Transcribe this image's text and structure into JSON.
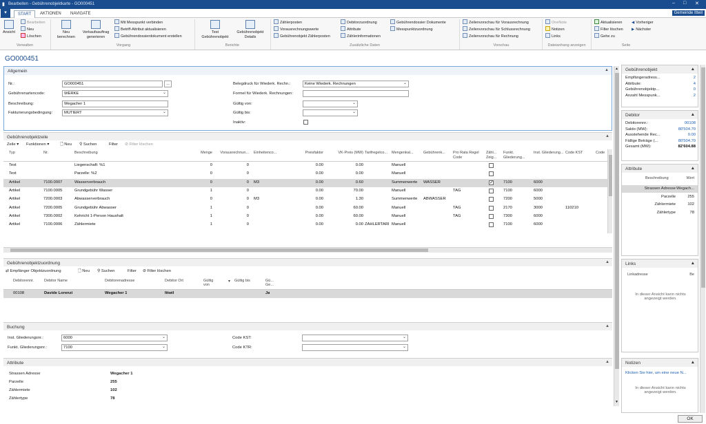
{
  "window": {
    "title": "Bearbeiten - Gebührenobjektkarte - GO000451",
    "company": "Gemeinde Ittwil"
  },
  "tabs": [
    "START",
    "AKTIONEN",
    "NAVIGATE"
  ],
  "ribbon": {
    "verwalten": {
      "label": "Verwalten",
      "ansicht": "Ansicht",
      "bearbeiten": "Bearbeiten",
      "neu": "Neu",
      "loeschen": "Löschen"
    },
    "vorgang": {
      "label": "Vorgang",
      "neu_berechnen": "Neu berechnen",
      "verkaufsauftrag": "Verkaufsauftrag generieren",
      "messpunkt": "Mit Messpunkt verbinden",
      "betriff": "Betriff-Attribut aktualisieren",
      "dokument": "Gebührendossierdokument erstellen"
    },
    "berichte": {
      "label": "Berichte",
      "test": "Test Gebührenobjekt",
      "details": "Gebührenobjekt Details"
    },
    "zusatz": {
      "label": "Zusätzliche Daten",
      "zaehlerposten": "Zählerposten",
      "vorausrechnungswerte": "Vorausrechnungswerte",
      "gebuehrenobjekt_zaehlerposten": "Gebührenobjekt Zählerposten",
      "debitorzuordnung": "Debitorzuordnung",
      "attribute": "Attribute",
      "zaehlerinformationen": "Zählerinformationen",
      "dossier": "Gebührendossier Dokumente",
      "messpunktzuordnung": "Messpunktzuordnung"
    },
    "vorschau": {
      "label": "Vorschau",
      "v1": "Zeilenvorschau für Vorausrechnung",
      "v2": "Zeilenvorschau für Schlussrechnung",
      "v3": "Zeilenvorschau für Rechnung"
    },
    "datei": {
      "label": "Dateianhang anzeigen",
      "onenote": "OneNote",
      "notizen": "Notizen",
      "links": "Links"
    },
    "seite": {
      "label": "Seite",
      "aktualisieren": "Aktualisieren",
      "filter": "Filter löschen",
      "gehe": "Gehe zu",
      "vorheriger": "Vorheriger",
      "naechster": "Nächster"
    }
  },
  "page_title": "GO000451",
  "allgemein": {
    "title": "Allgemein",
    "nr_label": "Nr.:",
    "nr": "GO000451",
    "art_label": "Gebührenartencode:",
    "art": "WERKE",
    "beschr_label": "Beschreibung:",
    "beschr": "Wegacher 1",
    "fakt_label": "Fakturierungsbedingung:",
    "fakt": "MUTIERT",
    "beleg_label": "Belegdruck für Wiederk. Rechn.:",
    "beleg": "Keine Wiederk. Rechnungen",
    "formel_label": "Formel für Wiederk. Rechnungen:",
    "formel": "",
    "von_label": "Gültig von:",
    "bis_label": "Gültig bis:",
    "inaktiv_label": "Inaktiv:"
  },
  "zeile": {
    "title": "Gebührenobjektzeile",
    "toolbar": [
      "Zeile",
      "Funktionen",
      "Neu",
      "Suchen",
      "Filter",
      "Filter löschen"
    ],
    "headers": [
      "Typ",
      "Nr.",
      "Beschreibung",
      "Menge",
      "Vorausrechnun...",
      "Einheitenco...",
      "Preisfaktor",
      "VK-Preis (MW)",
      "Tarifregelco...",
      "Mengenkal...",
      "Gebührenk...",
      "Pro Rata Regel Code",
      "Zähl... Zeig...",
      "Funkt. Gliederung...",
      "Inst. Gliederung...",
      "Code KST",
      "Code"
    ],
    "rows": [
      {
        "typ": "Text",
        "nr": "",
        "beschr": "Liegenschaft: %1",
        "menge": "0",
        "vor": "0",
        "einh": "",
        "preis": "0.00",
        "vk": "0.00",
        "tarif": "",
        "mengen": "Manuell",
        "gebk": "",
        "prorata": "",
        "chk": false,
        "funkt": "",
        "inst": "",
        "kst": ""
      },
      {
        "typ": "Text",
        "nr": "",
        "beschr": "Parzelle: %2",
        "menge": "0",
        "vor": "0",
        "einh": "",
        "preis": "0.00",
        "vk": "0.00",
        "tarif": "",
        "mengen": "Manuell",
        "gebk": "",
        "prorata": "",
        "chk": false,
        "funkt": "",
        "inst": "",
        "kst": ""
      },
      {
        "typ": "Artikel",
        "nr": "7100.0007",
        "beschr": "Wasserverbrauch",
        "menge": "0",
        "vor": "0",
        "einh": "M3",
        "preis": "0.00",
        "vk": "0.60",
        "tarif": "",
        "mengen": "Summenwerte",
        "gebk": "WASSER",
        "prorata": "",
        "chk": true,
        "funkt": "7100",
        "inst": "6000",
        "kst": "",
        "sel": true
      },
      {
        "typ": "Artikel",
        "nr": "7100.0005",
        "beschr": "Grundgebühr Wasser",
        "menge": "1",
        "vor": "0",
        "einh": "",
        "preis": "0.00",
        "vk": "70.00",
        "tarif": "",
        "mengen": "Manuell",
        "gebk": "",
        "prorata": "TAG",
        "chk": false,
        "funkt": "7100",
        "inst": "6000",
        "kst": ""
      },
      {
        "typ": "Artikel",
        "nr": "7200.0003",
        "beschr": "Abwasserverbrauch",
        "menge": "0",
        "vor": "0",
        "einh": "M3",
        "preis": "0.00",
        "vk": "1.30",
        "tarif": "",
        "mengen": "Summenwerte",
        "gebk": "ABWASSER",
        "prorata": "",
        "chk": false,
        "funkt": "7200",
        "inst": "5000",
        "kst": ""
      },
      {
        "typ": "Artikel",
        "nr": "7200.0005",
        "beschr": "Grundgebühr Abwasser",
        "menge": "1",
        "vor": "0",
        "einh": "",
        "preis": "0.00",
        "vk": "60.00",
        "tarif": "",
        "mengen": "Manuell",
        "gebk": "",
        "prorata": "TAG",
        "chk": false,
        "funkt": "2170",
        "inst": "3000",
        "kst": "110210"
      },
      {
        "typ": "Artikel",
        "nr": "7300.0002",
        "beschr": "Kehricht 1-Person Haushalt",
        "menge": "1",
        "vor": "0",
        "einh": "",
        "preis": "0.00",
        "vk": "60.00",
        "tarif": "",
        "mengen": "Manuell",
        "gebk": "",
        "prorata": "TAG",
        "chk": false,
        "funkt": "7300",
        "inst": "6000",
        "kst": ""
      },
      {
        "typ": "Artikel",
        "nr": "7100.0006",
        "beschr": "Zählermiete",
        "menge": "1",
        "vor": "0",
        "einh": "",
        "preis": "0.00",
        "vk": "0.00",
        "tarif": "ZÄHLERTARI",
        "mengen": "Manuell",
        "gebk": "",
        "prorata": "",
        "chk": false,
        "funkt": "7100",
        "inst": "6000",
        "kst": ""
      }
    ]
  },
  "zuordnung": {
    "title": "Gebührenobjektzuordnung",
    "toolbar": [
      "Empfänger Objektzuordnung",
      "Neu",
      "Suchen",
      "Filter",
      "Filter löschen"
    ],
    "headers": [
      "Debitorennr.",
      "Debitor Name",
      "Debitorenadresse",
      "Debitor Ort",
      "Gültig von",
      "Gültig bis",
      "Gü... Ge..."
    ],
    "row": {
      "nr": "00108",
      "name": "Davide Lorenzi",
      "adresse": "Wegacher 1",
      "ort": "Ittwil",
      "von": "",
      "bis": "",
      "gue": "Ja"
    }
  },
  "buchung": {
    "title": "Buchung",
    "inst_label": "Inst. Gliederungsnr.:",
    "inst": "6000",
    "funkt_label": "Funkt. Gliederungsnr.:",
    "funkt": "7100",
    "kst_label": "Code KST:",
    "ktr_label": "Code KTR:"
  },
  "attribute": {
    "title": "Attribute",
    "items": [
      {
        "label": "Strassen Adresse",
        "value": "Wegacher 1"
      },
      {
        "label": "Parzelle",
        "value": "255"
      },
      {
        "label": "Zählermiete",
        "value": "102"
      },
      {
        "label": "Zählertype",
        "value": "78"
      }
    ]
  },
  "factbox": {
    "geb": {
      "title": "Gebührenobjekt",
      "items": [
        {
          "label": "Empfängeradress...",
          "value": "2"
        },
        {
          "label": "Attribute:",
          "value": "4"
        },
        {
          "label": "Gebührenobjektp...",
          "value": "0"
        },
        {
          "label": "Anzahl Messpunk...",
          "value": "2"
        }
      ]
    },
    "deb": {
      "title": "Debitor",
      "items": [
        {
          "label": "Debitorennr.:",
          "value": "00108"
        },
        {
          "label": "Saldo (MW):",
          "value": "80'504.70"
        },
        {
          "label": "Ausstehende Rec...",
          "value": "0.00"
        },
        {
          "label": "Fällige Beträge (...",
          "value": "80'504.70"
        },
        {
          "label": "Gesamt (MW):",
          "value": "82'604.88"
        }
      ]
    },
    "attr": {
      "title": "Attribute",
      "col1": "Beschreibung",
      "col2": "Wert",
      "items": [
        {
          "label": "Strassen Adresse",
          "value": "Wegach..."
        },
        {
          "label": "Parzelle",
          "value": "255"
        },
        {
          "label": "Zählermiete",
          "value": "102"
        },
        {
          "label": "Zählertype",
          "value": "78"
        }
      ]
    },
    "links": {
      "title": "Links",
      "col": "Linkadresse",
      "col2": "Be",
      "empty": "In dieser Ansicht kann nichts angezeigt werden."
    },
    "notizen": {
      "title": "Notizen",
      "link": "Klicken Sie hier, um eine neue N...",
      "empty": "In dieser Ansicht kann nichts angezeigt werden."
    }
  },
  "ok": "OK"
}
